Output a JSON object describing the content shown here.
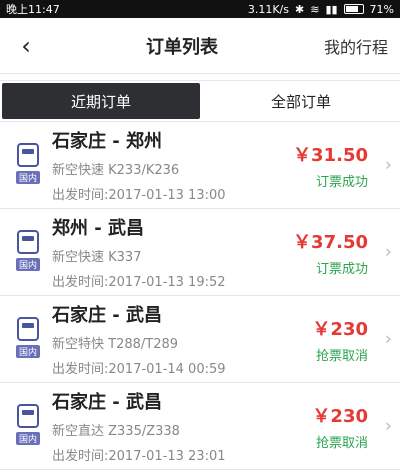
{
  "statusbar": {
    "time": "晚上11:47",
    "net": "3.11K/s",
    "battery": "71%"
  },
  "header": {
    "title": "订单列表",
    "my_trip": "我的行程"
  },
  "tabs": [
    {
      "label": "近期订单",
      "active": true
    },
    {
      "label": "全部订单",
      "active": false
    }
  ],
  "colors": {
    "success": "#2aa44f",
    "cancelled": "#2aa44f",
    "price": "#e53935",
    "train_icon": "#4a55a0"
  },
  "orders": [
    {
      "route": "石家庄 - 郑州",
      "train": "新空快速 K233/K236",
      "departure": "出发时间:2017-01-13 13:00",
      "price": "￥31.50",
      "status": "订票成功",
      "badge": "国内"
    },
    {
      "route": "郑州 - 武昌",
      "train": "新空快速 K337",
      "departure": "出发时间:2017-01-13 19:52",
      "price": "￥37.50",
      "status": "订票成功",
      "badge": "国内"
    },
    {
      "route": "石家庄 - 武昌",
      "train": "新空特快 T288/T289",
      "departure": "出发时间:2017-01-14 00:59",
      "price": "￥230",
      "status": "抢票取消",
      "badge": "国内"
    },
    {
      "route": "石家庄 - 武昌",
      "train": "新空直达 Z335/Z338",
      "departure": "出发时间:2017-01-13 23:01",
      "price": "￥230",
      "status": "抢票取消",
      "badge": "国内"
    }
  ]
}
